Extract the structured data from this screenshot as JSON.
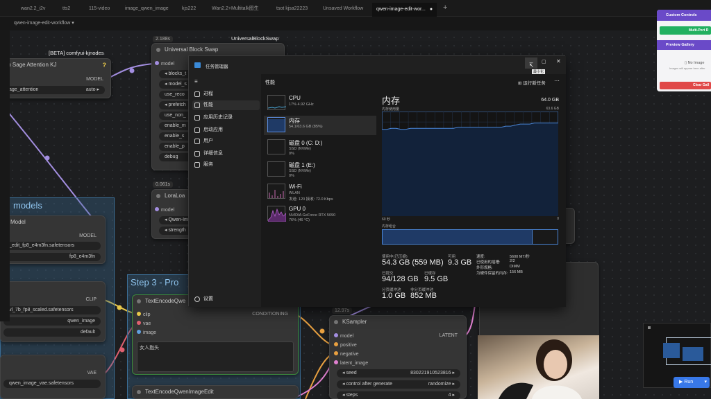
{
  "tabs": [
    "wan2.2_i2v",
    "tts2",
    "115-video",
    "image_qwen_image",
    "kjs222",
    "Wan2.2+Multitalk图生",
    "tsot kjsa22223",
    "Unsaved Workflow",
    "qwen-image-edit-wor..."
  ],
  "tab_add": "+",
  "workflow_select": "qwen-image-edit-workflow",
  "nodes": {
    "sage": {
      "group_title": "[BETA] comfyui-kjnodes",
      "title": "tch Sage Attention KJ",
      "in": "del",
      "out": "MODEL",
      "widget_label": "age_attention",
      "widget_value": "auto",
      "help": "?"
    },
    "block_swap": {
      "badge": "2.188s",
      "group_title": "UniversalBlockSwap",
      "title": "Universal Block Swap",
      "in": "model",
      "widgets": [
        "blocks_t",
        "model_s",
        "use_reco",
        "prefetch",
        "use_non_",
        "enable_m",
        "enable_s",
        "enable_p",
        "debug"
      ]
    },
    "lora": {
      "badge": "0.061s",
      "title": "LoraLoa",
      "in": "model",
      "widgets": [
        "Qwen-Im",
        "strength"
      ]
    },
    "models": {
      "group_title": "models",
      "title": "Model",
      "out": "MODEL",
      "widgets": [
        "_edit_fp8_e4m3fn.safetensors",
        "fp8_e4m3fn"
      ]
    },
    "clip": {
      "out": "CLIP",
      "widgets": [
        "vl_7b_fp8_scaled.safetensors",
        "qwen_image",
        "default"
      ]
    },
    "vae": {
      "out": "VAE",
      "widgets": [
        "qwen_image_vae.safetensors"
      ]
    },
    "step3": {
      "group_title": "Step 3 - Pro",
      "title": "TextEncodeQwe",
      "inputs": [
        "clip",
        "vae",
        "image"
      ],
      "out": "CONDITIONING",
      "prompt": "女人抱头"
    },
    "text2": {
      "title": "TextEncodeQwenImageEdit"
    },
    "ksampler": {
      "badge": "12.97s",
      "title": "KSampler",
      "inputs": [
        "model",
        "positive",
        "negative",
        "latent_image"
      ],
      "out": "LATENT",
      "seed_label": "seed",
      "seed_value": "830221910523816",
      "cag_label": "control after generate",
      "cag_value": "randomize",
      "steps_label": "steps",
      "steps_value": "4"
    }
  },
  "right_panel": {
    "custom_controls": "Custom Controls",
    "multi_port": "Multi-Port R",
    "preview_gallery": "Preview Gallery",
    "no_images": "No Image",
    "no_images_sub": "Images will appear here after",
    "clear": "Clear Gall"
  },
  "run_button": "Run",
  "task_manager": {
    "title": "任务管理器",
    "nav": [
      "进程",
      "性能",
      "应用历史记录",
      "启动应用",
      "用户",
      "详细信息",
      "服务"
    ],
    "settings": "设置",
    "header": "性能",
    "run_task": "运行新任务",
    "tooltip": "最小化",
    "devices": [
      {
        "name": "CPU",
        "sub": "17% 4.92 GHz"
      },
      {
        "name": "内存",
        "sub": "54.1/63.6 GB (85%)"
      },
      {
        "name": "磁盘 0 (C: D:)",
        "sub": "SSD (NVMe)",
        "sub2": "0%"
      },
      {
        "name": "磁盘 1 (E:)",
        "sub": "SSD (NVMe)",
        "sub2": "0%"
      },
      {
        "name": "Wi-Fi",
        "sub": "WLAN",
        "sub2": "发送: 120 接收: 72.0 Kbps"
      },
      {
        "name": "GPU 0",
        "sub": "NVIDIA GeForce RTX 5090",
        "sub2": "76% (46 °C)"
      }
    ],
    "detail_title": "内存",
    "detail_total": "64.0 GB",
    "usage_label": "内存使用量",
    "usage_max": "63.6 GB",
    "time_label": "60 秒",
    "time_zero": "0",
    "composition_label": "内存组合",
    "memory_history": [
      83,
      83,
      84,
      84,
      83,
      83,
      84,
      84,
      84,
      84,
      84,
      84,
      84,
      84,
      84,
      84,
      85,
      85,
      85,
      85,
      85,
      85,
      85,
      85,
      85,
      85,
      86,
      86,
      87,
      88,
      88,
      88,
      89,
      89,
      89,
      89,
      89,
      89
    ],
    "stats": [
      {
        "label": "使用中(已压缩)",
        "value": "54.3 GB (559 MB)"
      },
      {
        "label": "可用",
        "value": "9.3 GB"
      },
      {
        "label": "已提交",
        "value": "94/128 GB"
      },
      {
        "label": "已缓存",
        "value": "9.5 GB"
      },
      {
        "label": "分页缓冲池",
        "value": "1.0 GB"
      },
      {
        "label": "非分页缓冲池",
        "value": "852 MB"
      }
    ],
    "kv": [
      {
        "k": "速度:",
        "v": "5600 MT/秒"
      },
      {
        "k": "已使用的插槽:",
        "v": "2/2"
      },
      {
        "k": "外形规格:",
        "v": "DIMM"
      },
      {
        "k": "为硬件保留的内存:",
        "v": "156 MB"
      }
    ],
    "colors": {
      "accent": "#5d8fe0",
      "graph_fill": "#12223a",
      "graph_line": "#4a86d8"
    }
  }
}
